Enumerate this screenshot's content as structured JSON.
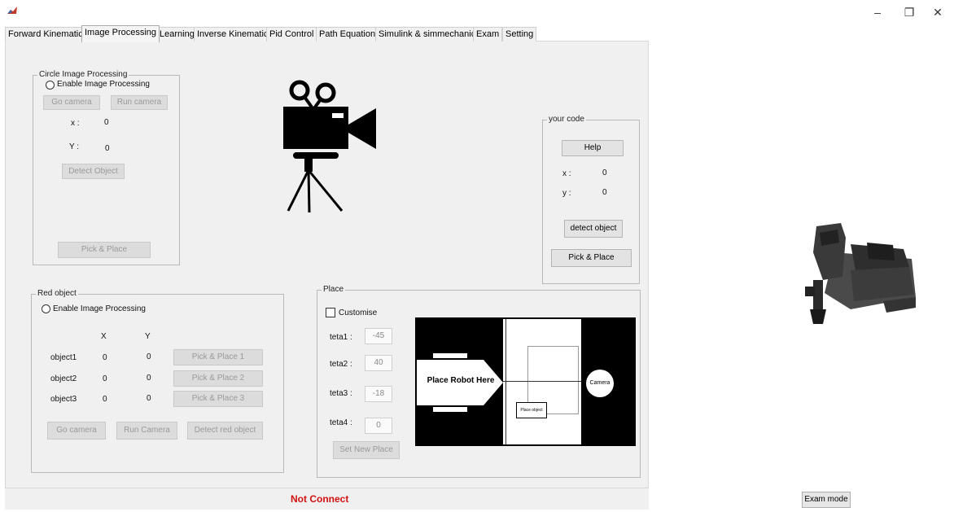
{
  "window": {
    "minimize_glyph": "–",
    "restore_glyph": "❐",
    "close_glyph": "✕"
  },
  "tabs": [
    {
      "label": "Forward Kinematic",
      "active": false
    },
    {
      "label": "Image Processing",
      "active": true
    },
    {
      "label": "Learning",
      "active": false
    },
    {
      "label": "Inverse Kinematic",
      "active": false
    },
    {
      "label": "Pid Control",
      "active": false
    },
    {
      "label": "Path Equation",
      "active": false
    },
    {
      "label": "Simulink & simmechanic",
      "active": false
    },
    {
      "label": "Exam",
      "active": false
    },
    {
      "label": "Setting",
      "active": false
    }
  ],
  "circle_panel": {
    "title": "Circle  Image Processing",
    "enable_label": "Enable Image Processing",
    "go_camera": "Go camera",
    "run_camera": "Run camera",
    "x_label": "x :",
    "x_value": "0",
    "y_label": "Y :",
    "y_value": "0",
    "detect_object": "Detect Object",
    "pick_place": "Pick & Place"
  },
  "your_code_panel": {
    "title": "your code",
    "help": "Help",
    "x_label": "x :",
    "x_value": "0",
    "y_label": "y :",
    "y_value": "0",
    "detect_object": "detect object",
    "pick_place": "Pick & Place"
  },
  "red_panel": {
    "title": "Red object",
    "enable_label": "Enable Image Processing",
    "col_x": "X",
    "col_y": "Y",
    "objects": [
      {
        "name": "object1",
        "x": "0",
        "y": "0",
        "button": "Pick & Place 1"
      },
      {
        "name": "object2",
        "x": "0",
        "y": "0",
        "button": "Pick & Place 2"
      },
      {
        "name": "object3",
        "x": "0",
        "y": "0",
        "button": "Pick & Place 3"
      }
    ],
    "go_camera": "Go camera",
    "run_camera": "Run Camera",
    "detect_red": "Detect red object"
  },
  "place_panel": {
    "title": "Place",
    "customise": "Customise",
    "tetas": [
      {
        "label": "teta1 :",
        "value": "-45"
      },
      {
        "label": "teta2 :",
        "value": "40"
      },
      {
        "label": "teta3 :",
        "value": "-18"
      },
      {
        "label": "teta4 :",
        "value": "0"
      }
    ],
    "set_new_place": "Set New Place",
    "map_robot_label": "Place Robot Here",
    "map_camera_label": "Camera",
    "map_object_label": "Place object"
  },
  "status": {
    "text": "Not Connect",
    "color": "#d01010"
  },
  "exam_mode": "Exam mode"
}
